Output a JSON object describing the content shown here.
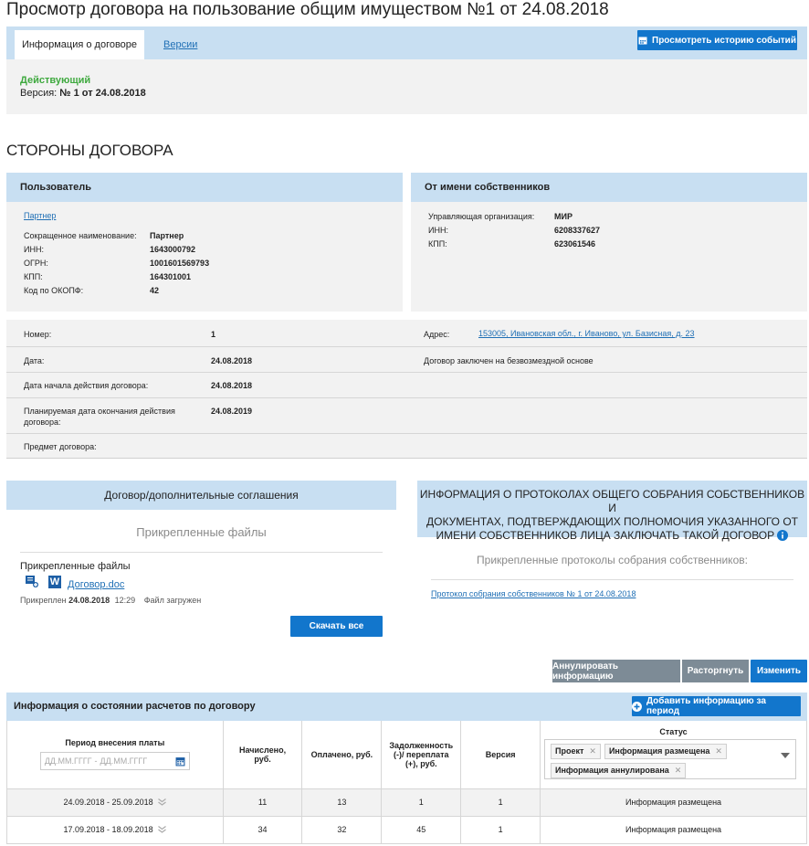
{
  "page_title": "Просмотр договора на пользование общим имуществом №1 от 24.08.2018",
  "tabs": [
    {
      "label": "Информация о договоре"
    },
    {
      "label": "Версии"
    }
  ],
  "history_button": "Просмотреть историю событий",
  "status": {
    "state": "Действующий",
    "version_label": "Версия:",
    "version_value": "№ 1 от 24.08.2018"
  },
  "section_parties": "СТОРОНЫ ДОГОВОРА",
  "user_party": {
    "header": "Пользователь",
    "link": "Партнер",
    "fields": [
      {
        "label": "Сокращенное наименование:",
        "value": "Партнер"
      },
      {
        "label": "ИНН:",
        "value": "1643000792"
      },
      {
        "label": "ОГРН:",
        "value": "1001601569793"
      },
      {
        "label": "КПП:",
        "value": "164301001"
      },
      {
        "label": "Код по ОКОПФ:",
        "value": "42"
      }
    ]
  },
  "owner_party": {
    "header": "От имени собственников",
    "fields": [
      {
        "label": "Управляющая организация:",
        "value": "МИР"
      },
      {
        "label": "ИНН:",
        "value": "6208337627"
      },
      {
        "label": "КПП:",
        "value": "623061546"
      }
    ]
  },
  "contract_info": {
    "number_label": "Номер:",
    "number_value": "1",
    "address_label": "Адрес:",
    "address_value": "153005, Ивановская обл., г. Иваново, ул. Базисная, д. 23",
    "date_label": "Дата:",
    "date_value": "24.08.2018",
    "free_note": "Договор заключен на безвозмездной основе",
    "start_label": "Дата начала действия договора:",
    "start_value": "24.08.2018",
    "end_label_1": "Планируемая дата окончания действия",
    "end_label_2": "договора:",
    "end_value": "24.08.2019",
    "subject_label": "Предмет договора:"
  },
  "agreements_card": {
    "header": "Договор/дополнительные соглашения",
    "subtitle": "Прикрепленные файлы",
    "files_label": "Прикрепленные файлы",
    "file_name": "Договор.doc",
    "attached_prefix": "Прикреплен",
    "attached_date": "24.08.2018",
    "attached_time": "12:29",
    "file_status": "Файл загружен",
    "download_button": "Скачать все"
  },
  "protocols_card": {
    "header_1": "ИНФОРМАЦИЯ О ПРОТОКОЛАХ ОБЩЕГО СОБРАНИЯ СОБСТВЕННИКОВ И",
    "header_2": "ДОКУМЕНТАХ, ПОДТВЕРЖДАЮЩИХ ПОЛНОМОЧИЯ УКАЗАННОГО ОТ",
    "header_3": "ИМЕНИ СОБСТВЕННИКОВ ЛИЦА ЗАКЛЮЧАТЬ ТАКОЙ ДОГОВОР",
    "subtitle": "Прикрепленные протоколы собрания собственников:",
    "protocol_link": "Протокол собрания собственников № 1 от 24.08.2018"
  },
  "actions": {
    "annul": "Аннулировать информацию",
    "terminate": "Расторгнуть",
    "edit": "Изменить"
  },
  "calc_section": {
    "title": "Информация о состоянии расчетов по договору",
    "add_button": "Добавить информацию за период",
    "columns": {
      "period": "Период внесения платы",
      "accrued_1": "Начислено,",
      "accrued_2": "руб.",
      "paid": "Оплачено, руб.",
      "debt_1": "Задолженность",
      "debt_2": "(-)/ переплата",
      "debt_3": "(+), руб.",
      "version": "Версия",
      "status": "Статус"
    },
    "date_from_placeholder": "ДД.ММ.ГГГГ",
    "date_to_placeholder": "ДД.ММ.ГГГГ",
    "date_separator": "-",
    "status_tags": [
      "Проект",
      "Информация размещена",
      "Информация аннулирована"
    ],
    "rows": [
      {
        "period": "24.09.2018 - 25.09.2018",
        "accrued": "11",
        "paid": "13",
        "debt": "1",
        "version": "1",
        "status": "Информация размещена"
      },
      {
        "period": "17.09.2018 - 18.09.2018",
        "accrued": "34",
        "paid": "32",
        "debt": "45",
        "version": "1",
        "status": "Информация размещена"
      }
    ]
  },
  "colors": {
    "accent_blue": "#1276cc",
    "header_blue": "#c8dff2",
    "status_green": "#3ea93e",
    "grey_button": "#7d8b96"
  }
}
